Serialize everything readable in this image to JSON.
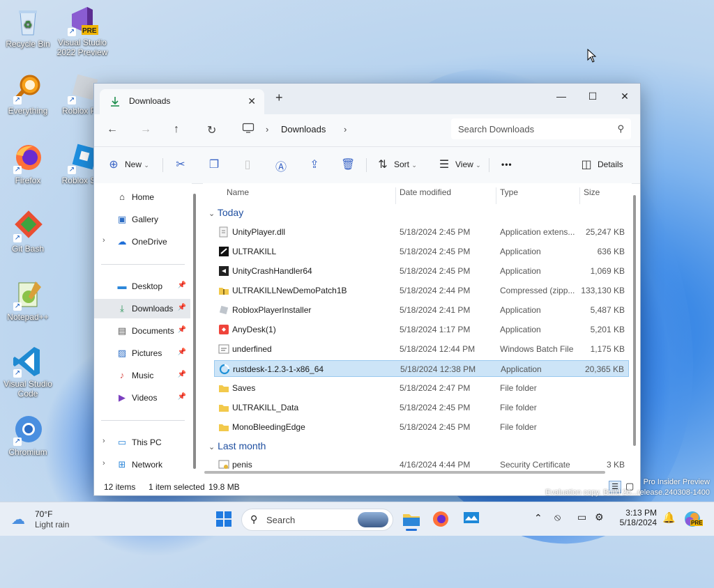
{
  "desktop": {
    "icons": [
      {
        "label": "Recycle Bin"
      },
      {
        "label": "Visual Studio 2022 Preview",
        "badge": "PRE"
      },
      {
        "label": "Everything"
      },
      {
        "label": "Roblox Pla"
      },
      {
        "label": "Firefox"
      },
      {
        "label": "Roblox Stu"
      },
      {
        "label": "Git Bash"
      },
      {
        "label": "Notepad++"
      },
      {
        "label": "Visual Studio Code"
      },
      {
        "label": "Chromium"
      }
    ],
    "watermark_line1": "Pro Insider Preview",
    "watermark_line2": "Evaluation copy. Build 26...release.240308-1400"
  },
  "window": {
    "tab_title": "Downloads",
    "new_tab": "+",
    "breadcrumb": "Downloads",
    "search_placeholder": "Search Downloads",
    "toolbar": {
      "new_label": "New",
      "sort_label": "Sort",
      "view_label": "View",
      "more_label": "•••",
      "details_label": "Details"
    },
    "sidebar": {
      "home": "Home",
      "gallery": "Gallery",
      "onedrive": "OneDrive",
      "desktop": "Desktop",
      "downloads": "Downloads",
      "documents": "Documents",
      "pictures": "Pictures",
      "music": "Music",
      "videos": "Videos",
      "thispc": "This PC",
      "network": "Network"
    },
    "columns": {
      "name": "Name",
      "date": "Date modified",
      "type": "Type",
      "size": "Size"
    },
    "groups": {
      "today": "Today",
      "last_month": "Last month"
    },
    "rows": [
      {
        "name": "UnityPlayer.dll",
        "date": "5/18/2024 2:45 PM",
        "type": "Application extens...",
        "size": "25,247 KB"
      },
      {
        "name": "ULTRAKILL",
        "date": "5/18/2024 2:45 PM",
        "type": "Application",
        "size": "636 KB"
      },
      {
        "name": "UnityCrashHandler64",
        "date": "5/18/2024 2:45 PM",
        "type": "Application",
        "size": "1,069 KB"
      },
      {
        "name": "ULTRAKILLNewDemoPatch1B",
        "date": "5/18/2024 2:44 PM",
        "type": "Compressed (zipp...",
        "size": "133,130 KB"
      },
      {
        "name": "RobloxPlayerInstaller",
        "date": "5/18/2024 2:41 PM",
        "type": "Application",
        "size": "5,487 KB"
      },
      {
        "name": "AnyDesk(1)",
        "date": "5/18/2024 1:17 PM",
        "type": "Application",
        "size": "5,201 KB"
      },
      {
        "name": "underfined",
        "date": "5/18/2024 12:44 PM",
        "type": "Windows Batch File",
        "size": "1,175 KB"
      },
      {
        "name": "rustdesk-1.2.3-1-x86_64",
        "date": "5/18/2024 12:38 PM",
        "type": "Application",
        "size": "20,365 KB"
      },
      {
        "name": "Saves",
        "date": "5/18/2024 2:47 PM",
        "type": "File folder",
        "size": ""
      },
      {
        "name": "ULTRAKILL_Data",
        "date": "5/18/2024 2:45 PM",
        "type": "File folder",
        "size": ""
      },
      {
        "name": "MonoBleedingEdge",
        "date": "5/18/2024 2:45 PM",
        "type": "File folder",
        "size": ""
      }
    ],
    "last_month_row": {
      "name": "penis",
      "date": "4/16/2024 4:44 PM",
      "type": "Security Certificate",
      "size": "3 KB"
    },
    "status": {
      "count": "12 items",
      "selected": "1 item selected",
      "size": "19.8 MB"
    }
  },
  "taskbar": {
    "weather_temp": "70°F",
    "weather_desc": "Light rain",
    "search_label": "Search",
    "time": "3:13 PM",
    "date": "5/18/2024",
    "copilot_badge": "PRE"
  }
}
